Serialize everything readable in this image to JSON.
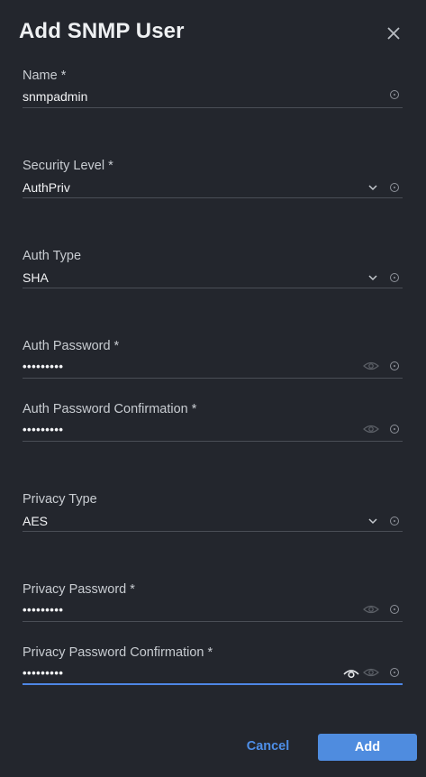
{
  "dialog": {
    "title": "Add SNMP User",
    "close_icon": "close-icon"
  },
  "fields": {
    "name": {
      "label": "Name *",
      "value": "snmpadmin"
    },
    "security_level": {
      "label": "Security Level *",
      "value": "AuthPriv"
    },
    "auth_type": {
      "label": "Auth Type",
      "value": "SHA"
    },
    "auth_password": {
      "label": "Auth Password *",
      "value": "•••••••••"
    },
    "auth_password_confirm": {
      "label": "Auth Password Confirmation *",
      "value": "•••••••••"
    },
    "privacy_type": {
      "label": "Privacy Type",
      "value": "AES"
    },
    "privacy_password": {
      "label": "Privacy Password *",
      "value": "•••••••••"
    },
    "privacy_password_confirm": {
      "label": "Privacy Password Confirmation *",
      "value": "•••••••••"
    }
  },
  "actions": {
    "cancel_label": "Cancel",
    "add_label": "Add"
  },
  "colors": {
    "background": "#23262d",
    "accent": "#4f8cdf",
    "active_underline": "#4e86e4"
  }
}
